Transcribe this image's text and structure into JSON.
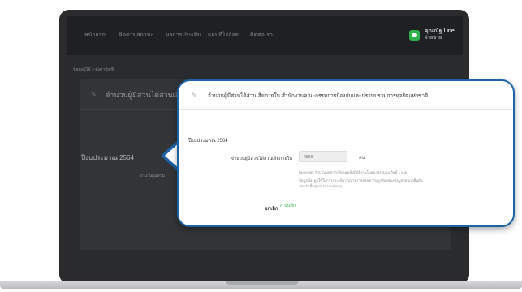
{
  "nav": {
    "items": [
      "หน้าแรก",
      "ติดตามสถานะ",
      "ผลการประเมิน",
      "แผนที่ไร่อ้อย",
      "ติดต่อเรา"
    ],
    "user_label": "คุณณัฐ Line",
    "user_sub": "ฝ่ายขาย"
  },
  "breadcrumb": "ข้อมูลผู้ใช้ > ตั้งค่าบัญชี",
  "card": {
    "title": "จำนวนผู้มีส่วนได้ส่วนเสีย",
    "year_label": "ปีงบประมาณ 2564",
    "small_label": "จำนวนผู้มีส่วน"
  },
  "popup": {
    "title": "จำนวนผู้มีส่วนได้ส่วนเสียภายใน สำนักงานคณะกรรมการป้องกันและปราบปรามการทุจริตแห่งชาติ",
    "year_title": "ปีงบประมาณ 2564",
    "field_label": "จำนวนผู้มีส่วนได้ส่วนเสียภายใน",
    "field_value": "2558",
    "field_unit": "คน",
    "note1": "หมายเหตุ: จำนวนบุคลากรทั้งหมดที่ปฏิบัติงานในหน่วยงาน ณ วันที่ 1 ต.ค.",
    "note2": "ข้อมูลนี้จะถูกใช้ในการประเมิน กรุณาตรวจสอบความถูกต้องของข้อมูลก่อนกดยืนยัน",
    "note3": "ก่อนวันสิ้นสุดการกรอกข้อมูล",
    "cancel_label": "ยกเลิก",
    "ok_label": "✓ บันทึก"
  },
  "colors": {
    "accent": "#1d63a6",
    "line_green": "#2fb04a",
    "confirm_green": "#3cb55a"
  }
}
